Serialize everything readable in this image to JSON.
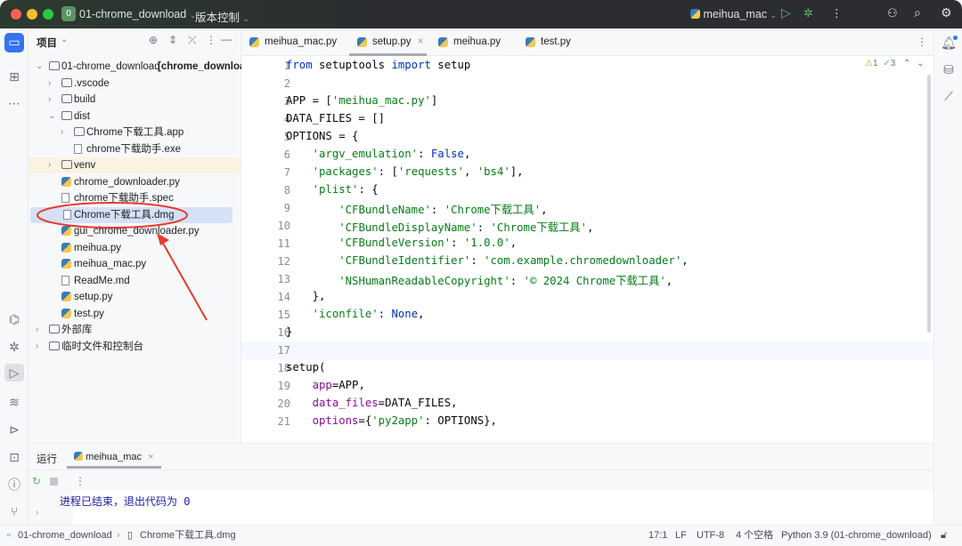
{
  "titlebar": {
    "project": "01-chrome_download",
    "project_badge": "0",
    "vcs": "版本控制",
    "run_config": "meihua_mac"
  },
  "project_panel": {
    "title": "项目",
    "tree": [
      {
        "label": "01-chrome_download",
        "suffix": " [chrome_download]",
        "level": 0,
        "type": "folder",
        "open": true
      },
      {
        "label": ".vscode",
        "level": 1,
        "type": "folder",
        "open": false
      },
      {
        "label": "build",
        "level": 1,
        "type": "folder",
        "open": false
      },
      {
        "label": "dist",
        "level": 1,
        "type": "folder",
        "open": true
      },
      {
        "label": "Chrome下载工具.app",
        "level": 2,
        "type": "folder",
        "open": false
      },
      {
        "label": "chrome下载助手.exe",
        "level": 2,
        "type": "file"
      },
      {
        "label": "venv",
        "level": 1,
        "type": "folder",
        "open": false,
        "highlight": "venv"
      },
      {
        "label": "chrome_downloader.py",
        "level": 1,
        "type": "py"
      },
      {
        "label": "chrome下载助手.spec",
        "level": 1,
        "type": "file"
      },
      {
        "label": "Chrome下载工具.dmg",
        "level": 1,
        "type": "file",
        "selected": true
      },
      {
        "label": "gui_chrome_downloader.py",
        "level": 1,
        "type": "py"
      },
      {
        "label": "meihua.py",
        "level": 1,
        "type": "py"
      },
      {
        "label": "meihua_mac.py",
        "level": 1,
        "type": "py"
      },
      {
        "label": "ReadMe.md",
        "level": 1,
        "type": "md"
      },
      {
        "label": "setup.py",
        "level": 1,
        "type": "py"
      },
      {
        "label": "test.py",
        "level": 1,
        "type": "py"
      },
      {
        "label": "外部库",
        "level": 0,
        "type": "lib",
        "open": false
      },
      {
        "label": "临时文件和控制台",
        "level": 0,
        "type": "scratch",
        "open": false
      }
    ]
  },
  "editor": {
    "tabs": [
      {
        "label": "meihua_mac.py"
      },
      {
        "label": "setup.py",
        "active": true
      },
      {
        "label": "meihua.py"
      },
      {
        "label": "test.py"
      }
    ],
    "inspections": {
      "warnings": "1",
      "ok": "3"
    },
    "current_line": 17,
    "lines": [
      [
        [
          "from",
          "kw"
        ],
        [
          " setuptools ",
          ""
        ],
        [
          "import",
          "kw"
        ],
        [
          " setup",
          ""
        ]
      ],
      [],
      [
        [
          "APP = [",
          ""
        ],
        [
          "'meihua_mac.py'",
          "str"
        ],
        [
          "]",
          ""
        ]
      ],
      [
        [
          "DATA_FILES = []",
          ""
        ]
      ],
      [
        [
          "OPTIONS = {",
          ""
        ]
      ],
      [
        [
          "    ",
          ""
        ],
        [
          "'argv_emulation'",
          "str"
        ],
        [
          ": ",
          ""
        ],
        [
          "False",
          "kw"
        ],
        [
          ",",
          ""
        ]
      ],
      [
        [
          "    ",
          ""
        ],
        [
          "'packages'",
          "str"
        ],
        [
          ": [",
          ""
        ],
        [
          "'requests'",
          "str"
        ],
        [
          ", ",
          ""
        ],
        [
          "'bs4'",
          "str"
        ],
        [
          "],",
          ""
        ]
      ],
      [
        [
          "    ",
          ""
        ],
        [
          "'plist'",
          "str"
        ],
        [
          ": {",
          ""
        ]
      ],
      [
        [
          "        ",
          ""
        ],
        [
          "'CFBundleName'",
          "str"
        ],
        [
          ": ",
          ""
        ],
        [
          "'Chrome下载工具'",
          "str"
        ],
        [
          ",",
          ""
        ]
      ],
      [
        [
          "        ",
          ""
        ],
        [
          "'CFBundleDisplayName'",
          "str"
        ],
        [
          ": ",
          ""
        ],
        [
          "'Chrome下载工具'",
          "str"
        ],
        [
          ",",
          ""
        ]
      ],
      [
        [
          "        ",
          ""
        ],
        [
          "'CFBundleVersion'",
          "str"
        ],
        [
          ": ",
          ""
        ],
        [
          "'1.0.0'",
          "str"
        ],
        [
          ",",
          ""
        ]
      ],
      [
        [
          "        ",
          ""
        ],
        [
          "'CFBundleIdentifier'",
          "str"
        ],
        [
          ": ",
          ""
        ],
        [
          "'com.example.chromedownloader'",
          "str"
        ],
        [
          ",",
          ""
        ]
      ],
      [
        [
          "        ",
          ""
        ],
        [
          "'NSHumanReadableCopyright'",
          "str"
        ],
        [
          ": ",
          ""
        ],
        [
          "'© 2024 Chrome下载工具'",
          "str"
        ],
        [
          ",",
          ""
        ]
      ],
      [
        [
          "    },",
          ""
        ]
      ],
      [
        [
          "    ",
          ""
        ],
        [
          "'iconfile'",
          "str"
        ],
        [
          ": ",
          ""
        ],
        [
          "None",
          "kw"
        ],
        [
          ",",
          ""
        ]
      ],
      [
        [
          "}",
          ""
        ]
      ],
      [],
      [
        [
          "setup(",
          ""
        ]
      ],
      [
        [
          "    ",
          ""
        ],
        [
          "app",
          "prm"
        ],
        [
          "=APP,",
          ""
        ]
      ],
      [
        [
          "    ",
          ""
        ],
        [
          "data_files",
          "prm"
        ],
        [
          "=DATA_FILES,",
          ""
        ]
      ],
      [
        [
          "    ",
          ""
        ],
        [
          "options",
          "prm"
        ],
        [
          "={",
          ""
        ],
        [
          "'py2app'",
          "str"
        ],
        [
          ": OPTIONS},",
          ""
        ]
      ]
    ]
  },
  "run_panel": {
    "title": "运行",
    "tab": "meihua_mac",
    "output": "进程已结束，退出代码为 0"
  },
  "statusbar": {
    "breadcrumb": [
      "01-chrome_download",
      "Chrome下载工具.dmg"
    ],
    "position": "17:1",
    "line_sep": "LF",
    "encoding": "UTF-8",
    "indent": "4 个空格",
    "interpreter": "Python 3.9 (01-chrome_download)"
  },
  "colors": {
    "accent": "#3574f0",
    "annotation": "#e8392f",
    "keyword": "#0033b3",
    "string": "#067d17"
  }
}
